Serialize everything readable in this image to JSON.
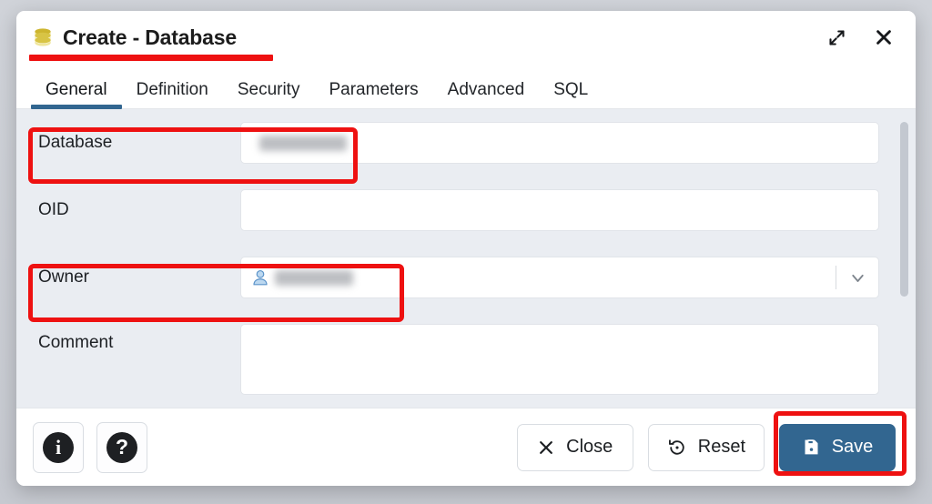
{
  "window": {
    "title": "Create - Database",
    "icon": "database-icon",
    "maximize_label": "Maximize",
    "close_label": "Close"
  },
  "tabs": [
    {
      "label": "General",
      "active": true
    },
    {
      "label": "Definition",
      "active": false
    },
    {
      "label": "Security",
      "active": false
    },
    {
      "label": "Parameters",
      "active": false
    },
    {
      "label": "Advanced",
      "active": false
    },
    {
      "label": "SQL",
      "active": false
    }
  ],
  "form": {
    "rows": [
      {
        "label": "Database",
        "type": "text",
        "value": "",
        "redacted": true
      },
      {
        "label": "OID",
        "type": "text",
        "value": "",
        "redacted": false
      },
      {
        "label": "Owner",
        "type": "select",
        "value": "",
        "redacted": true,
        "icon": "user-icon"
      },
      {
        "label": "Comment",
        "type": "textarea",
        "value": "",
        "redacted": false
      }
    ]
  },
  "footer": {
    "info_label": "i",
    "help_label": "?",
    "close_label": "Close",
    "reset_label": "Reset",
    "save_label": "Save"
  },
  "colors": {
    "accent": "#326690",
    "annotation": "#ee1111",
    "form_background": "#eaedf2",
    "dialog_background": "#ffffff",
    "page_background": "#c9ccd2"
  },
  "annotations": [
    {
      "name": "title-underline"
    },
    {
      "name": "database-field-highlight"
    },
    {
      "name": "owner-field-highlight"
    },
    {
      "name": "save-button-highlight"
    }
  ]
}
